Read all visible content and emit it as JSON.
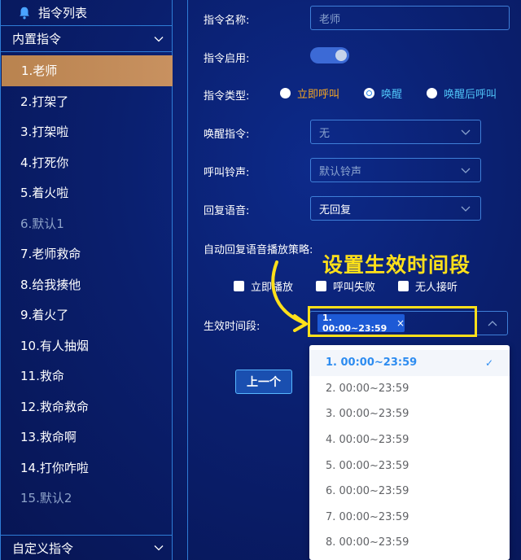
{
  "sidebar": {
    "title": "指令列表",
    "builtin_group": "内置指令",
    "custom_group": "自定义指令",
    "items": [
      {
        "label": "1.老师",
        "state": "active"
      },
      {
        "label": "2.打架了",
        "state": "normal"
      },
      {
        "label": "3.打架啦",
        "state": "normal"
      },
      {
        "label": "4.打死你",
        "state": "normal"
      },
      {
        "label": "5.着火啦",
        "state": "normal"
      },
      {
        "label": "6.默认1",
        "state": "dim"
      },
      {
        "label": "7.老师救命",
        "state": "normal"
      },
      {
        "label": "8.给我揍他",
        "state": "normal"
      },
      {
        "label": "9.着火了",
        "state": "normal"
      },
      {
        "label": "10.有人抽烟",
        "state": "normal"
      },
      {
        "label": "11.救命",
        "state": "normal"
      },
      {
        "label": "12.救命救命",
        "state": "normal"
      },
      {
        "label": "13.救命啊",
        "state": "normal"
      },
      {
        "label": "14.打你咋啦",
        "state": "normal"
      },
      {
        "label": "15.默认2",
        "state": "dim"
      }
    ]
  },
  "form": {
    "name_label": "指令名称:",
    "name_placeholder": "老师",
    "enable_label": "指令启用:",
    "type_label": "指令类型:",
    "type_options": [
      "立即呼叫",
      "唤醒",
      "唤醒后呼叫"
    ],
    "wake_label": "唤醒指令:",
    "wake_value": "无",
    "ring_label": "呼叫铃声:",
    "ring_value": "默认铃声",
    "reply_label": "回复语音:",
    "reply_value": "无回复",
    "strategy_label": "自动回复语音播放策略:",
    "strategy_options": [
      "立即播放",
      "呼叫失败",
      "无人接听"
    ],
    "period_label": "生效时间段:",
    "period_tag": "1. 00:00~23:59",
    "tag_close": "×",
    "prev_button": "上一个"
  },
  "annotation": "设置生效时间段",
  "dropdown": {
    "items": [
      "1. 00:00~23:59",
      "2. 00:00~23:59",
      "3. 00:00~23:59",
      "4. 00:00~23:59",
      "5. 00:00~23:59",
      "6. 00:00~23:59",
      "7. 00:00~23:59",
      "8. 00:00~23:59"
    ],
    "selected_check": "✓"
  },
  "colors": {
    "accent": "#2d8cf0",
    "active_item": "#c08a58",
    "annotation": "#ffe01a",
    "radio_call": "#f5a623",
    "radio_wake_call": "#4fc3f7"
  }
}
